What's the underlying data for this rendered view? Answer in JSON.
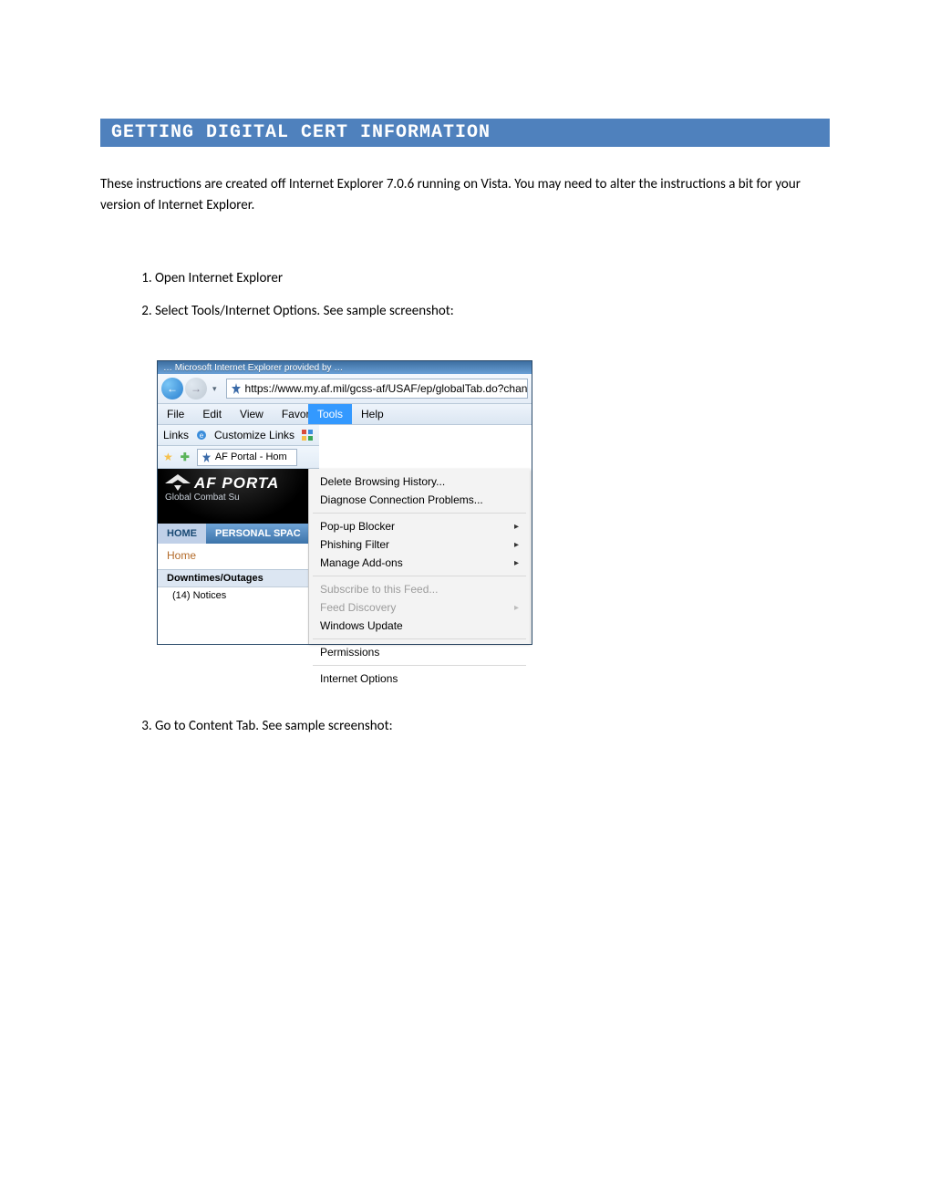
{
  "heading": "GETTING DIGITAL CERT INFORMATION",
  "intro": "These instructions are created off Internet Explorer 7.0.6 running on Vista.  You may need to alter the instructions a bit for your version of Internet Explorer.",
  "steps": {
    "s1": "Open Internet Explorer",
    "s2": "Select Tools/Internet Options.  See sample screenshot:",
    "s3": "Go to Content Tab.  See sample screenshot:"
  },
  "screenshot": {
    "titlebar_cut": "… Microsoft Internet Explorer provided by …",
    "nav": {
      "back": "←",
      "forward": "→",
      "caret": "▾"
    },
    "addr_url": "https://www.my.af.mil/gcss-af/USAF/ep/globalTab.do?channell",
    "menus": {
      "file": "File",
      "edit": "Edit",
      "view": "View",
      "favorites": "Favorites",
      "tools": "Tools",
      "help": "Help"
    },
    "linksbar": {
      "links": "Links",
      "customize": "Customize Links"
    },
    "favbar": {
      "tab": "AF Portal - Hom"
    },
    "banner": {
      "title": "AF PORTA",
      "sub": "Global Combat Su"
    },
    "tabstrip": {
      "home": "HOME",
      "personal": "PERSONAL SPAC"
    },
    "home_link": "Home",
    "side": {
      "head": "Downtimes/Outages",
      "row": "(14) Notices"
    },
    "dropdown": {
      "del": "Delete Browsing History...",
      "diag": "Diagnose Connection Problems...",
      "popup": "Pop-up Blocker",
      "phish": "Phishing Filter",
      "addons": "Manage Add-ons",
      "feed": "Subscribe to this Feed...",
      "feeddisc": "Feed Discovery",
      "wu": "Windows Update",
      "perm": "Permissions",
      "io": "Internet Options"
    }
  }
}
